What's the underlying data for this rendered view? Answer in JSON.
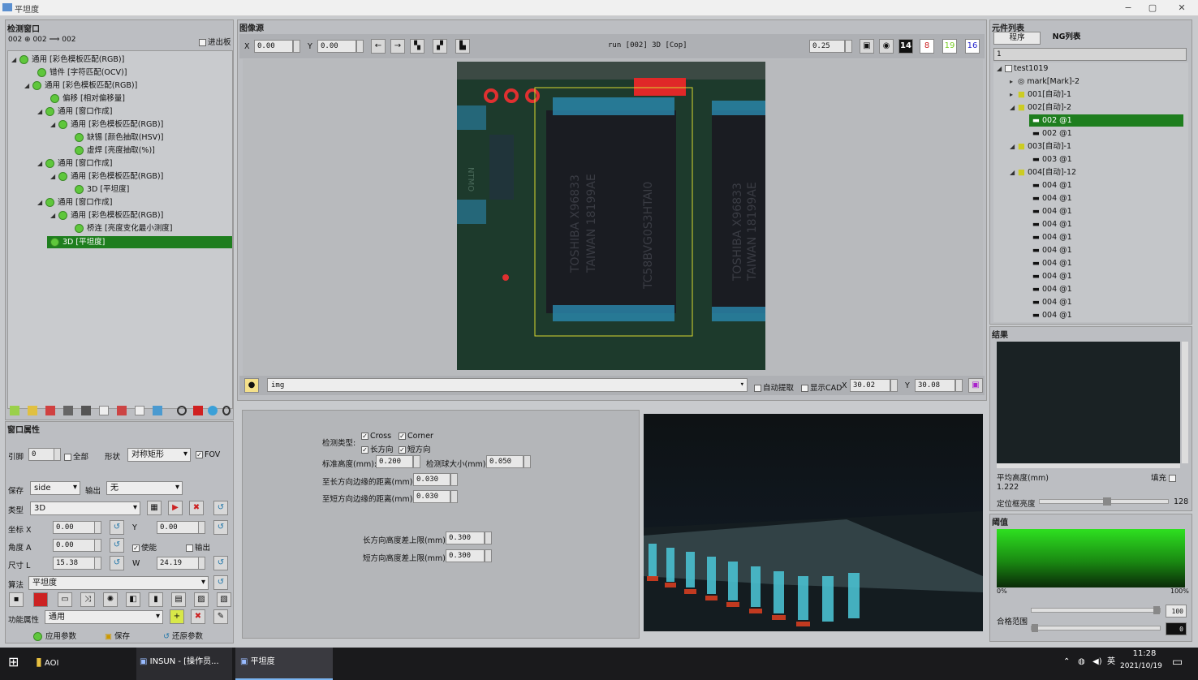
{
  "window": {
    "title": "平坦度",
    "min": "−",
    "max": "▢",
    "close": "✕"
  },
  "left": {
    "header": "检测窗口",
    "path": "002 ⊕ 002 ⟹ 002",
    "exit_label": "进出板",
    "tree": [
      "通用 [彩色模板匹配(RGB)]",
      "错件 [字符匹配(OCV)]",
      "通用 [彩色模板匹配(RGB)]",
      "偏移 [相对偏移量]",
      "通用 [窗口作成]",
      "通用 [彩色模板匹配(RGB)]",
      "缺锡 [颜色抽取(HSV)]",
      "虚焊 [亮度抽取(%)]",
      "通用 [窗口作成]",
      "通用 [彩色模板匹配(RGB)]",
      "3D [平坦度]",
      "通用 [窗口作成]",
      "通用 [彩色模板匹配(RGB)]",
      "桥连 [亮度变化最小测度]",
      "3D [平坦度]"
    ]
  },
  "props": {
    "header": "窗口属性",
    "pin_label": "引脚",
    "pin_value": "0",
    "all_label": "全部",
    "shape_label": "形状",
    "shape_value": "对称矩形",
    "fov_label": "FOV",
    "save_label": "保存",
    "save_value": "side",
    "output_label": "输出",
    "output_value": "无",
    "type_label": "类型",
    "type_value": "3D",
    "coord_label": "坐标 X",
    "coord_x": "0.00",
    "coord_y_label": "Y",
    "coord_y": "0.00",
    "angle_label": "角度 A",
    "angle_value": "0.00",
    "enable_label": "使能",
    "out2_label": "输出",
    "size_label": "尺寸 L",
    "size_l": "15.38",
    "size_w_label": "W",
    "size_w": "24.19",
    "algo_label": "算法",
    "algo_value": "平坦度",
    "func_label": "功能属性",
    "func_value": "通用",
    "apply_label": "应用参数",
    "save2_label": "保存",
    "restore_label": "还原参数"
  },
  "image": {
    "header": "图像源",
    "x_label": "X",
    "x_value": "0.00",
    "y_label": "Y",
    "y_value": "0.00",
    "run_text": "run [002] 3D [Cop]",
    "zoom": "0.25",
    "btn14": "14",
    "btn8": "8",
    "btn19": "19",
    "btn16": "16",
    "src_value": "img",
    "auto_label": "自动提取",
    "cad_label": "显示CAD",
    "bx_label": "X",
    "bx_value": "30.02",
    "by_label": "Y",
    "by_value": "30.08",
    "chip1a": "TOSHIBA X96833",
    "chip1b": "TAIWAN 18199AE",
    "chip2": "TC58BVG0S3HTAI0",
    "chip3a": "TOSHIBA X96833",
    "chip3b": "TAIWAN 18199AE",
    "silk": "NTMO"
  },
  "params": {
    "type_label": "检测类型:",
    "cross": "Cross",
    "corner": "Corner",
    "long": "长方向",
    "short": "短方向",
    "std_label": "标准高度(mm):",
    "std_value": "0.200",
    "ball_label": "检测球大小(mm):",
    "ball_value": "0.050",
    "dlong_label": "至长方向边缘的距离(mm):",
    "dlong_value": "0.030",
    "dshort_label": "至短方向边缘的距离(mm):",
    "dshort_value": "0.030",
    "hlong_label": "长方向高度差上限(mm):",
    "hlong_value": "0.300",
    "hshort_label": "短方向高度差上限(mm):",
    "hshort_value": "0.300"
  },
  "components": {
    "header": "元件列表",
    "tab1": "程序",
    "tab2": "NG列表",
    "field": "1",
    "items": [
      "test1019",
      "mark[Mark]-2",
      "001[自动]-1",
      "002[自动]-2",
      "002 @1",
      "002 @1",
      "003[自动]-1",
      "003 @1",
      "004[自动]-12",
      "004 @1",
      "004 @1",
      "004 @1",
      "004 @1",
      "004 @1",
      "004 @1",
      "004 @1",
      "004 @1",
      "004 @1",
      "004 @1",
      "004 @1"
    ]
  },
  "result": {
    "header": "结果",
    "avg_label": "平均高度(mm)",
    "avg_value": "1.222",
    "fill_label": "填充",
    "bright_label": "定位框亮度",
    "bright_value": "128"
  },
  "threshold": {
    "header": "阈值",
    "min": "0%",
    "max": "100%",
    "range_label": "合格范围",
    "r1": "100",
    "r2": "0"
  },
  "taskbar": {
    "item1": "AOI",
    "item2": "INSUN - [操作员...",
    "item3": "平坦度",
    "lang": "英",
    "time": "11:28",
    "date": "2021/10/19"
  },
  "colors": {
    "accent_green": "#1e7e1e",
    "threshold_green": "#37d62d",
    "pcb": "#1d3a2c"
  }
}
